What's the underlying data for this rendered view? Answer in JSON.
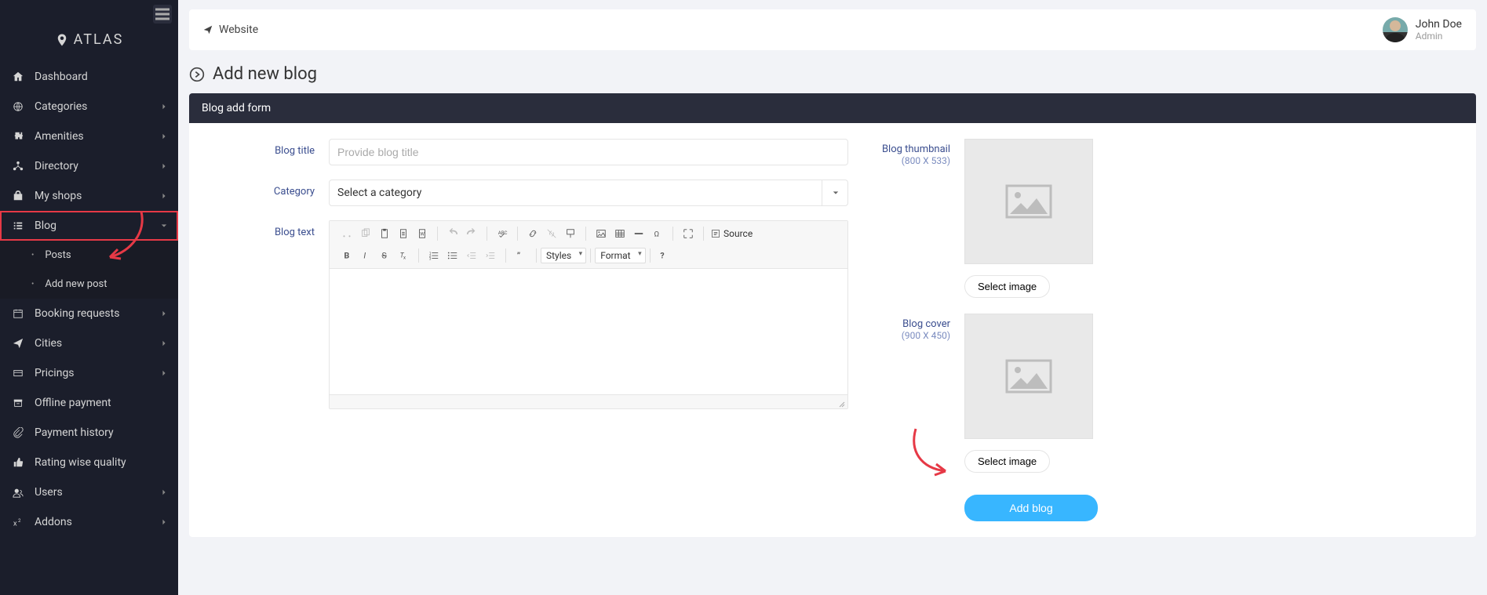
{
  "brand": "ATLAS",
  "topbar": {
    "website": "Website"
  },
  "user": {
    "name": "John Doe",
    "role": "Admin"
  },
  "sidebar": {
    "items": [
      {
        "label": "Dashboard",
        "icon": "home",
        "hasSub": false
      },
      {
        "label": "Categories",
        "icon": "globe",
        "hasSub": true
      },
      {
        "label": "Amenities",
        "icon": "puzzle",
        "hasSub": true
      },
      {
        "label": "Directory",
        "icon": "network",
        "hasSub": true
      },
      {
        "label": "My shops",
        "icon": "bag",
        "hasSub": true
      },
      {
        "label": "Blog",
        "icon": "list",
        "hasSub": true,
        "open": true,
        "highlighted": true,
        "children": [
          {
            "label": "Posts"
          },
          {
            "label": "Add new post"
          }
        ]
      },
      {
        "label": "Booking requests",
        "icon": "calendar",
        "hasSub": true
      },
      {
        "label": "Cities",
        "icon": "plane",
        "hasSub": true
      },
      {
        "label": "Pricings",
        "icon": "card",
        "hasSub": true
      },
      {
        "label": "Offline payment",
        "icon": "archive",
        "hasSub": false
      },
      {
        "label": "Payment history",
        "icon": "clip",
        "hasSub": false
      },
      {
        "label": "Rating wise quality",
        "icon": "like",
        "hasSub": false
      },
      {
        "label": "Users",
        "icon": "users",
        "hasSub": true
      },
      {
        "label": "Addons",
        "icon": "sup",
        "hasSub": true
      }
    ]
  },
  "page": {
    "title": "Add new blog",
    "panel": "Blog add form"
  },
  "form": {
    "title_label": "Blog title",
    "title_placeholder": "Provide blog title",
    "category_label": "Category",
    "category_placeholder": "Select a category",
    "text_label": "Blog text",
    "styles": "Styles",
    "format": "Format",
    "source": "Source",
    "thumb_label": "Blog thumbnail",
    "thumb_dim": "(800 X 533)",
    "cover_label": "Blog cover",
    "cover_dim": "(900 X 450)",
    "select_image": "Select image",
    "submit": "Add blog"
  }
}
